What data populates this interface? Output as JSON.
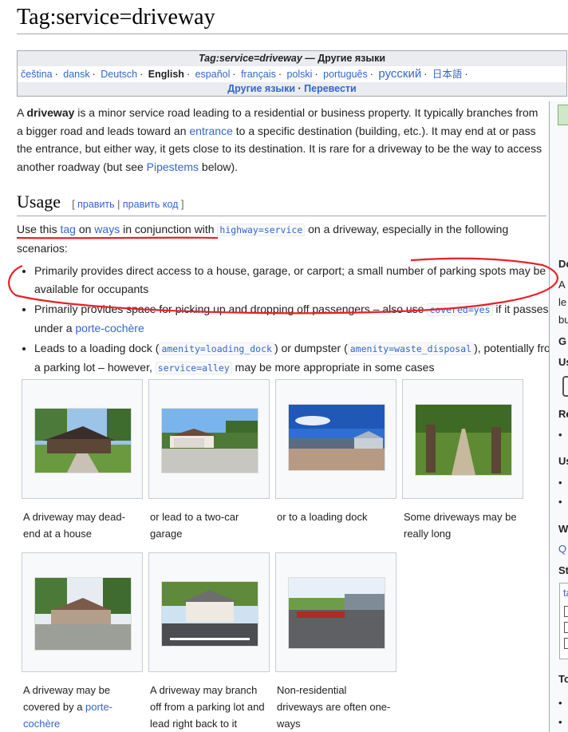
{
  "page": {
    "title": "Tag:service=driveway"
  },
  "langbox": {
    "header_italic": "Tag:service=driveway",
    "header_rest": " — Другие языки",
    "languages": [
      "čeština",
      "dansk",
      "Deutsch",
      "English",
      "español",
      "français",
      "polski",
      "português",
      "русский",
      "日本語"
    ],
    "current": "English",
    "other_languages": "Другие языки",
    "translate": "Перевести"
  },
  "intro": {
    "p1_a": "A ",
    "p1_b": "driveway",
    "p1_c": " is a minor service road leading to a residential or business property. It typically branches from a bigger road and leads toward an ",
    "p1_link1": "entrance",
    "p1_d": " to a specific destination (building, etc.). It may end at or pass the entrance, but either way, it gets close to its destination. It is rare for a driveway to be the way to access another roadway (but see ",
    "p1_link2": "Pipestems",
    "p1_e": " below)."
  },
  "usage": {
    "heading": "Usage",
    "edit_open": "[ ",
    "edit": "править",
    "edit_sep": " | ",
    "edit_code": "править код",
    "edit_close": " ]",
    "p_a": "Use this ",
    "p_tag": "tag",
    "p_b": " on ",
    "p_ways": "ways",
    "p_c": " in conjunction with ",
    "p_code": "highway=service",
    "p_d": " on a driveway, especially in the following scenarios:",
    "b1": "Primarily provides direct access to a house, garage, or carport; a small number of parking spots may be available for occupants",
    "b2_a": "Primarily provides space for picking up and dropping off passengers – also use ",
    "b2_code": "covered=yes",
    "b2_b": " if it passes under a ",
    "b2_link": "porte-cochère",
    "b3_a": "Leads to a loading dock (",
    "b3_code1": "amenity=loading_dock",
    "b3_b": ") or dumpster (",
    "b3_code2": "amenity=waste_disposal",
    "b3_c": "), potentially from a parking lot – however, ",
    "b3_code3": "service=alley",
    "b3_d": " may be more appropriate in some cases"
  },
  "gallery": {
    "captions": [
      "A driveway may dead-end at a house",
      "or lead to a two-car garage",
      "or to a loading dock",
      "Some driveways may be really long",
      "A driveway may be covered by a ",
      "A driveway may branch off from a parking lot and lead right back to it",
      "Non-residential driveways are often one-ways"
    ],
    "caption5_link": "porte-cochère"
  },
  "sidebar": {
    "letters": [
      "Do",
      "A",
      "le",
      "bu",
      "G",
      "Us",
      "Re",
      "Us",
      "W",
      "Q",
      "St",
      "ta",
      "To"
    ]
  },
  "colors": {
    "link": "#3366cc",
    "annotation": "#e8202a"
  }
}
